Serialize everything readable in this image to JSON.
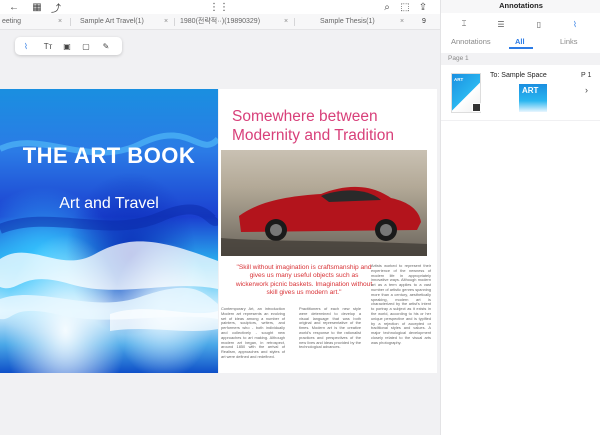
{
  "toolbar": {
    "back_icon": "←",
    "grid_icon": "▦",
    "share_icon": "⤴",
    "apps_icon": "⋮⋮",
    "search_icon": "⌕",
    "save_icon": "⬚",
    "export_icon": "⇪"
  },
  "tabs": [
    {
      "label": "eeting"
    },
    {
      "label": "Sample Art Travel(1)"
    },
    {
      "label": "1980(전략적··)(19890329)"
    },
    {
      "label": "Sample Thesis(1)"
    }
  ],
  "tabs_overflow": "9",
  "close_glyph": "×",
  "palette": {
    "tools": [
      "⌇",
      "Tт",
      "▣",
      "▢",
      "✎"
    ]
  },
  "document": {
    "left": {
      "title": "THE ART BOOK",
      "subtitle": "Art and Travel"
    },
    "right": {
      "title": "Somewhere between Modernity and Tradition",
      "quote": "\"Skill without imagination is craftsmanship and gives us many useful objects such as wickerwork picnic baskets. Imagination without skill gives us modern art.\"",
      "col1": "Contemporary Art, an introduction Modern art represents an evolving set of ideas among a number of painters, sculptors, writers, and performers who - both individually and collectively - sought new approaches to art making. Although modern art began, in retrospect, around 1850 with the arrival of Realism, approaches and styles of art were defined and redefined.",
      "col2": "Practitioners of each new style were determined to develop a visual language that was both original and representative of the times. Modern art is the creative world's response to the rationalist practices and perspectives of the new lives and ideas provided by the technological advances.",
      "col3": "Artists worked to represent their experience of the newness of modern life in appropriately innovative ways. Although modern art as a term applies to a vast number of artistic genres spanning more than a century, aesthetically speaking, modern art is characterized by the artist's intent to portray a subject as it exists in the world, according to his or her unique perspective and is typified by a rejection of accepted or traditional styles and values. A major technological development closely related to the visual arts was photography."
    }
  },
  "panel": {
    "title": "Annotations",
    "icons": [
      "⌶",
      "☰",
      "▯",
      "⌇"
    ],
    "sub_tabs": {
      "annotations": "Annotations",
      "all": "All",
      "links": "Links"
    },
    "page_header": "Page 1",
    "item": {
      "thumb_text": "ART",
      "to_label": "To: Sample Space",
      "page_no": "P 1",
      "dest_text": "ART",
      "chevron": "›"
    }
  }
}
